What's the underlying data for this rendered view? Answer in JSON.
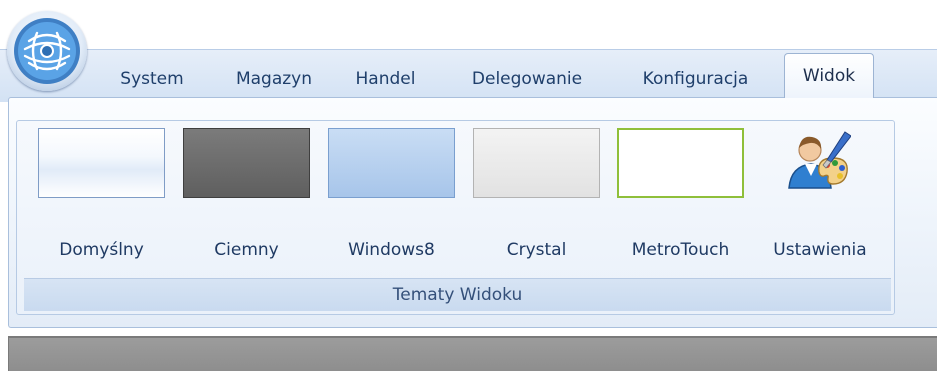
{
  "app": {
    "orb_icon": "app-orb-icon"
  },
  "tabs": [
    {
      "label": "System",
      "active": false
    },
    {
      "label": "Magazyn",
      "active": false
    },
    {
      "label": "Handel",
      "active": false
    },
    {
      "label": "Delegowanie",
      "active": false
    },
    {
      "label": "Konfiguracja",
      "active": false
    },
    {
      "label": "Widok",
      "active": true
    }
  ],
  "ribbon": {
    "group_title": "Tematy Widoku",
    "themes": [
      {
        "label": "Domyślny",
        "color": "#e1ebf8"
      },
      {
        "label": "Ciemny",
        "color": "#6b6b6b"
      },
      {
        "label": "Windows8",
        "color": "#b5cff0"
      },
      {
        "label": "Crystal",
        "color": "#e8e8e8"
      },
      {
        "label": "MetroTouch",
        "color": "#ffffff",
        "border": "#8fbf3a"
      }
    ],
    "settings": {
      "label": "Ustawienia",
      "icon": "user-palette-icon"
    }
  }
}
